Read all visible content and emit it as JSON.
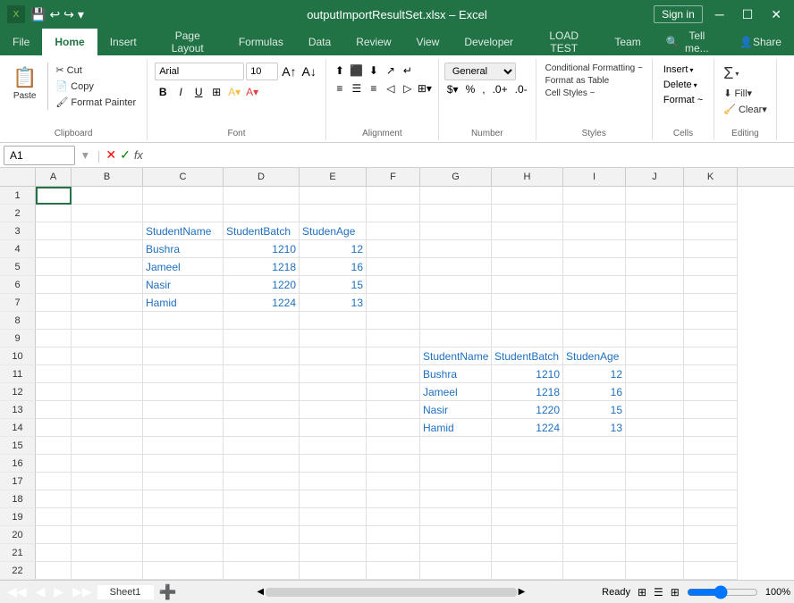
{
  "titleBar": {
    "filename": "outputImportResultSet.xlsx",
    "app": "Excel",
    "signIn": "Sign in",
    "windowControls": [
      "─",
      "☐",
      "✕"
    ]
  },
  "ribbon": {
    "tabs": [
      "File",
      "Home",
      "Insert",
      "Page Layout",
      "Formulas",
      "Data",
      "Review",
      "View",
      "Developer",
      "LOAD TEST",
      "Team"
    ],
    "activeTab": "Home",
    "tellMe": "Tell me...",
    "share": "Share",
    "groups": {
      "clipboard": {
        "label": "Clipboard",
        "pasteLabel": "Paste"
      },
      "font": {
        "label": "Font",
        "fontName": "Arial",
        "fontSize": "10"
      },
      "alignment": {
        "label": "Alignment"
      },
      "number": {
        "label": "Number",
        "format": "General"
      },
      "styles": {
        "label": "Styles",
        "conditionalFormatting": "Conditional Formatting ~",
        "formatAsTable": "Format as Table",
        "cellStyles": "Cell Styles ~"
      },
      "cells": {
        "label": "Cells",
        "insert": "Insert ~",
        "delete": "Delete ~",
        "format": "Format ~"
      },
      "editing": {
        "label": "Editing"
      }
    }
  },
  "formulaBar": {
    "nameBox": "A1",
    "fx": "fx"
  },
  "columns": [
    "A",
    "B",
    "C",
    "D",
    "E",
    "F",
    "G",
    "H",
    "I",
    "J",
    "K"
  ],
  "rows": 22,
  "cells": {
    "C3": {
      "value": "StudentName",
      "style": "header"
    },
    "D3": {
      "value": "StudentBatch",
      "style": "header"
    },
    "E3": {
      "value": "StudenAge",
      "style": "header"
    },
    "C4": {
      "value": "Bushra",
      "style": "blue"
    },
    "D4": {
      "value": "1210",
      "style": "blue",
      "align": "right"
    },
    "E4": {
      "value": "12",
      "style": "blue",
      "align": "right"
    },
    "C5": {
      "value": "Jameel",
      "style": "blue"
    },
    "D5": {
      "value": "1218",
      "style": "blue",
      "align": "right"
    },
    "E5": {
      "value": "16",
      "style": "blue",
      "align": "right"
    },
    "C6": {
      "value": "Nasir",
      "style": "blue"
    },
    "D6": {
      "value": "1220",
      "style": "blue",
      "align": "right"
    },
    "E6": {
      "value": "15",
      "style": "blue",
      "align": "right"
    },
    "C7": {
      "value": "Hamid",
      "style": "blue"
    },
    "D7": {
      "value": "1224",
      "style": "blue",
      "align": "right"
    },
    "E7": {
      "value": "13",
      "style": "blue",
      "align": "right"
    },
    "G10": {
      "value": "StudentName",
      "style": "header"
    },
    "H10": {
      "value": "StudentBatch",
      "style": "header"
    },
    "I10": {
      "value": "StudenAge",
      "style": "header"
    },
    "G11": {
      "value": "Bushra",
      "style": "blue"
    },
    "H11": {
      "value": "1210",
      "style": "blue",
      "align": "right"
    },
    "I11": {
      "value": "12",
      "style": "blue",
      "align": "right"
    },
    "G12": {
      "value": "Jameel",
      "style": "blue"
    },
    "H12": {
      "value": "1218",
      "style": "blue",
      "align": "right"
    },
    "I12": {
      "value": "16",
      "style": "blue",
      "align": "right"
    },
    "G13": {
      "value": "Nasir",
      "style": "blue"
    },
    "H13": {
      "value": "1220",
      "style": "blue",
      "align": "right"
    },
    "I13": {
      "value": "15",
      "style": "blue",
      "align": "right"
    },
    "G14": {
      "value": "Hamid",
      "style": "blue"
    },
    "H14": {
      "value": "1224",
      "style": "blue",
      "align": "right"
    },
    "I14": {
      "value": "13",
      "style": "blue",
      "align": "right"
    }
  },
  "sheets": [
    "Sheet1"
  ],
  "statusBar": {
    "status": "Ready",
    "zoom": "100%"
  }
}
